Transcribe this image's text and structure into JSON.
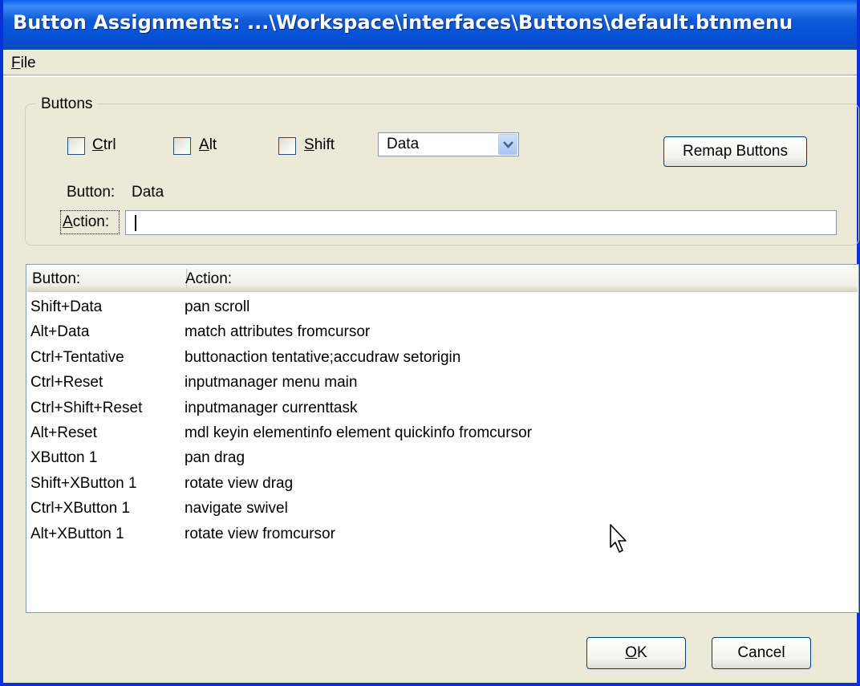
{
  "window": {
    "title": "Button Assignments: ...\\Workspace\\interfaces\\Buttons\\default.btnmenu"
  },
  "menu": {
    "file_underlined": "F",
    "file_rest": "ile"
  },
  "buttons_group": {
    "label": "Buttons",
    "ctrl": {
      "u": "C",
      "rest": "trl",
      "checked": false
    },
    "alt": {
      "u": "A",
      "rest": "lt",
      "checked": false
    },
    "shift": {
      "u": "S",
      "rest": "hift",
      "checked": false
    },
    "button_select": {
      "value": "Data"
    },
    "remap_label": "Remap Buttons",
    "button_caption": "Button:",
    "button_value": "Data",
    "action_u": "A",
    "action_rest": "ction:",
    "action_value": ""
  },
  "list": {
    "columns": [
      "Button:",
      "Action:"
    ],
    "rows": [
      {
        "button": "Shift+Data",
        "action": "pan scroll"
      },
      {
        "button": "Alt+Data",
        "action": "match attributes fromcursor"
      },
      {
        "button": "Ctrl+Tentative",
        "action": "buttonaction tentative;accudraw setorigin"
      },
      {
        "button": "Ctrl+Reset",
        "action": "inputmanager menu main"
      },
      {
        "button": "Ctrl+Shift+Reset",
        "action": "inputmanager currenttask"
      },
      {
        "button": "Alt+Reset",
        "action": "mdl keyin elementinfo element quickinfo fromcursor"
      },
      {
        "button": "XButton 1",
        "action": "pan drag"
      },
      {
        "button": "Shift+XButton 1",
        "action": "rotate view drag"
      },
      {
        "button": "Ctrl+XButton 1",
        "action": "navigate swivel"
      },
      {
        "button": "Alt+XButton 1",
        "action": "rotate view fromcursor"
      }
    ]
  },
  "footer": {
    "ok_u": "O",
    "ok_rest": "K",
    "cancel_label": "Cancel"
  },
  "colors": {
    "title_bar": "#0652d6",
    "dialog_bg": "#ece9d8",
    "input_border": "#7f9db9"
  }
}
